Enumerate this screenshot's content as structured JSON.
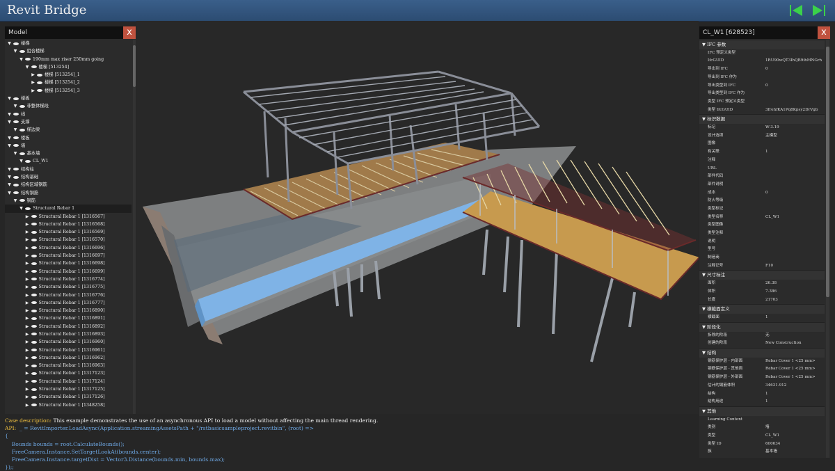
{
  "app": {
    "title": "Revit Bridge"
  },
  "model_panel": {
    "title": "Model",
    "close": "x",
    "rows": [
      {
        "level": 0,
        "label": "楼梯"
      },
      {
        "level": 1,
        "label": "组合楼梯"
      },
      {
        "level": 2,
        "label": "190mm max riser 250mm going"
      },
      {
        "level": 3,
        "label": "楼梯 [513254]"
      },
      {
        "level": 4,
        "label": "楼梯 [513254]_1"
      },
      {
        "level": 4,
        "label": "楼梯 [513254]_2"
      },
      {
        "level": 4,
        "label": "楼梯 [513254]_3"
      },
      {
        "level": 0,
        "label": "楼板"
      },
      {
        "level": 1,
        "label": "非整体梯段"
      },
      {
        "level": 0,
        "label": "线"
      },
      {
        "level": 0,
        "label": "支撑"
      },
      {
        "level": 1,
        "label": "梯边梁"
      },
      {
        "level": 0,
        "label": "楼板"
      },
      {
        "level": 0,
        "label": "墙"
      },
      {
        "level": 1,
        "label": "基本墙"
      },
      {
        "level": 2,
        "label": "CL_W1"
      },
      {
        "level": 0,
        "label": "结构柱"
      },
      {
        "level": 0,
        "label": "结构基础"
      },
      {
        "level": 0,
        "label": "结构区域钢筋"
      },
      {
        "level": 0,
        "label": "结构钢筋"
      },
      {
        "level": 1,
        "label": "钢筋"
      },
      {
        "level": 2,
        "label": "Structural Rebar 1",
        "selected": true
      },
      {
        "level": 3,
        "label": "Structural Rebar 1 [1316567]"
      },
      {
        "level": 3,
        "label": "Structural Rebar 1 [1316568]"
      },
      {
        "level": 3,
        "label": "Structural Rebar 1 [1316569]"
      },
      {
        "level": 3,
        "label": "Structural Rebar 1 [1316570]"
      },
      {
        "level": 3,
        "label": "Structural Rebar 1 [1316696]"
      },
      {
        "level": 3,
        "label": "Structural Rebar 1 [1316697]"
      },
      {
        "level": 3,
        "label": "Structural Rebar 1 [1316698]"
      },
      {
        "level": 3,
        "label": "Structural Rebar 1 [1316699]"
      },
      {
        "level": 3,
        "label": "Structural Rebar 1 [1316774]"
      },
      {
        "level": 3,
        "label": "Structural Rebar 1 [1316775]"
      },
      {
        "level": 3,
        "label": "Structural Rebar 1 [1316776]"
      },
      {
        "level": 3,
        "label": "Structural Rebar 1 [1316777]"
      },
      {
        "level": 3,
        "label": "Structural Rebar 1 [1316890]"
      },
      {
        "level": 3,
        "label": "Structural Rebar 1 [1316891]"
      },
      {
        "level": 3,
        "label": "Structural Rebar 1 [1316892]"
      },
      {
        "level": 3,
        "label": "Structural Rebar 1 [1316893]"
      },
      {
        "level": 3,
        "label": "Structural Rebar 1 [1316960]"
      },
      {
        "level": 3,
        "label": "Structural Rebar 1 [1316961]"
      },
      {
        "level": 3,
        "label": "Structural Rebar 1 [1316962]"
      },
      {
        "level": 3,
        "label": "Structural Rebar 1 [1316963]"
      },
      {
        "level": 3,
        "label": "Structural Rebar 1 [1317123]"
      },
      {
        "level": 3,
        "label": "Structural Rebar 1 [1317124]"
      },
      {
        "level": 3,
        "label": "Structural Rebar 1 [1317125]"
      },
      {
        "level": 3,
        "label": "Structural Rebar 1 [1317126]"
      },
      {
        "level": 3,
        "label": "Structural Rebar 1 [1348258]"
      }
    ]
  },
  "props_panel": {
    "title": "CL_W1 [628523]",
    "close": "x",
    "sections": [
      {
        "name": "IFC 参数",
        "rows": [
          [
            "IFC 预定义类型",
            ""
          ],
          [
            "IfcGUID",
            "1RU90wQT3IhQB9ihMNGrh"
          ],
          [
            "导出到 IFC",
            "0"
          ],
          [
            "导出到 IFC 作为",
            ""
          ],
          [
            "导出类型到 IFC",
            "0"
          ],
          [
            "导出类型到 IFC 作为",
            ""
          ],
          [
            "类型 IFC 预定义类型",
            ""
          ],
          [
            "类型 IfcGUID",
            "3frehfKA1Pq8Kpsy2DrVgb"
          ]
        ]
      },
      {
        "name": "标识数据",
        "rows": [
          [
            "标记",
            "W-3.19"
          ],
          [
            "设计选项",
            "主模型"
          ],
          [
            "图像",
            ""
          ],
          [
            "有关联",
            "1"
          ],
          [
            "注释",
            ""
          ],
          [
            "URL",
            ""
          ],
          [
            "部件代码",
            ""
          ],
          [
            "部件说明",
            ""
          ],
          [
            "成本",
            "0"
          ],
          [
            "防火等级",
            ""
          ],
          [
            "类型标记",
            ""
          ],
          [
            "类型名称",
            "CL_W1"
          ],
          [
            "类型图像",
            ""
          ],
          [
            "类型注释",
            ""
          ],
          [
            "说明",
            ""
          ],
          [
            "型号",
            ""
          ],
          [
            "制造商",
            ""
          ],
          [
            "注释记号",
            "F10"
          ]
        ]
      },
      {
        "name": "尺寸标注",
        "rows": [
          [
            "面积",
            "26.38"
          ],
          [
            "体积",
            "7.386"
          ],
          [
            "长度",
            "21703"
          ]
        ]
      },
      {
        "name": "横截面定义",
        "rows": [
          [
            "横截面",
            "1"
          ]
        ]
      },
      {
        "name": "阶段化",
        "rows": [
          [
            "拆除的阶段",
            "无"
          ],
          [
            "创建的阶段",
            "New Construction"
          ]
        ]
      },
      {
        "name": "结构",
        "rows": [
          [
            "钢筋保护层 - 内部面",
            "Rebar Cover 1 <25 mm>"
          ],
          [
            "钢筋保护层 - 其他面",
            "Rebar Cover 1 <25 mm>"
          ],
          [
            "钢筋保护层 - 外部面",
            "Rebar Cover 1 <25 mm>"
          ],
          [
            "估计的钢筋体积",
            "34631.912"
          ],
          [
            "结构",
            "1"
          ],
          [
            "结构用途",
            "1"
          ]
        ]
      },
      {
        "name": "其他",
        "rows": [
          [
            "Learning Content",
            ""
          ],
          [
            "类别",
            "墙"
          ],
          [
            "类型",
            "CL_W1"
          ],
          [
            "类型 ID",
            "600634"
          ],
          [
            "族",
            "基本墙"
          ]
        ]
      }
    ]
  },
  "code": {
    "desc_label": "Case description:",
    "desc_text": " This example demonstrates the use of an asynchronous API to load a model without affecting the main thread rendering.",
    "api_label": "API:",
    "lines": [
      "  _ = RevitImporter.LoadAsync(Application.streamingAssetsPath + \"/rstbasicsampleproject.revitbin\", (root) =>",
      "{",
      "    Bounds bounds = root.CalculateBounds();",
      "    FreeCamera.Instance.SetTargetLookAt(bounds.center);",
      "    FreeCamera.Instance.targetDist = Vector3.Distance(bounds.min, bounds.max);",
      "});;"
    ]
  },
  "colors": {
    "accent_green": "#3bd14a",
    "title_bg": "#34577f",
    "close_red": "#c0523f",
    "code_yellow": "#f0c040",
    "code_blue": "#6fa9e6"
  }
}
